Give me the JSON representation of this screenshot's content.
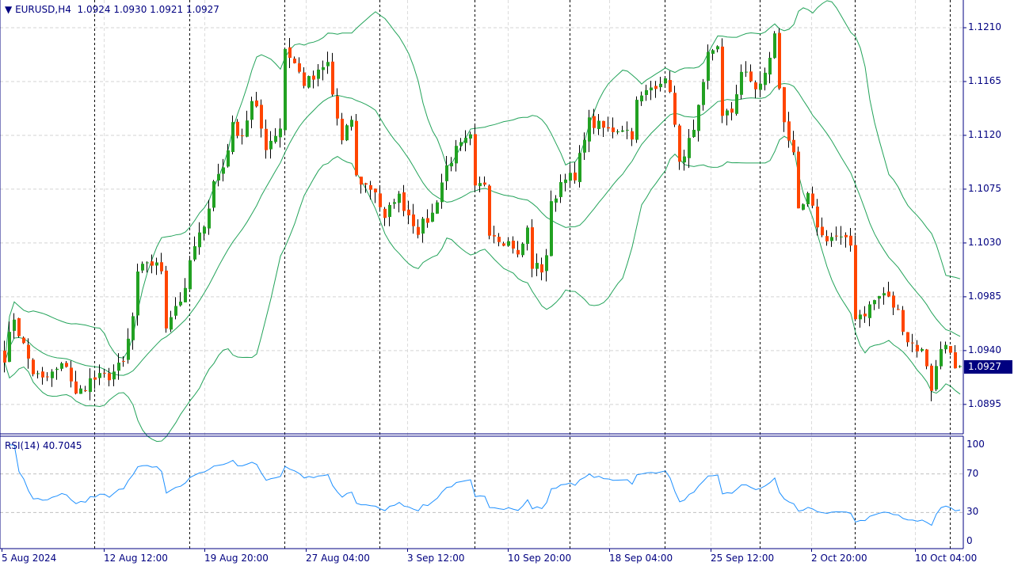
{
  "header": {
    "symbol": "EURUSD,H4",
    "ohlc": "1.0924 1.0930 1.0921 1.0927"
  },
  "last_price": "1.0927",
  "rsi_label": "RSI(14) 40.7045",
  "colors": {
    "bull": "#22a122",
    "bear": "#ff4500",
    "bands": "#23a35a",
    "rsi": "#1e90ff",
    "axis": "#000080",
    "tag": "#000080"
  },
  "chart_data": {
    "type": "candlestick",
    "title": "EURUSD,H4",
    "indicators": [
      "Bollinger Bands (20, 2)",
      "RSI(14)"
    ],
    "price_ticks": [
      "1.1210",
      "1.1165",
      "1.1120",
      "1.1075",
      "1.1030",
      "1.0985",
      "1.0940",
      "1.0895"
    ],
    "price_tick_values": [
      1.121,
      1.1165,
      1.112,
      1.1075,
      1.103,
      1.0985,
      1.094,
      1.0895
    ],
    "rsi_ticks": [
      "100",
      "70",
      "30",
      "0"
    ],
    "rsi_tick_values": [
      100,
      70,
      30,
      0
    ],
    "time_labels": [
      "5 Aug 2024",
      "12 Aug 12:00",
      "19 Aug 20:00",
      "27 Aug 04:00",
      "3 Sep 12:00",
      "10 Sep 20:00",
      "18 Sep 04:00",
      "25 Sep 12:00",
      "2 Oct 20:00",
      "10 Oct 04:00"
    ],
    "bar_count": 202,
    "close_path": [
      [
        0,
        1.0935
      ],
      [
        2,
        1.0968
      ],
      [
        3,
        1.0955
      ],
      [
        6,
        1.0922
      ],
      [
        8,
        1.0915
      ],
      [
        13,
        1.0929
      ],
      [
        15,
        1.0902
      ],
      [
        18,
        1.0915
      ],
      [
        22,
        1.0919
      ],
      [
        25,
        1.0929
      ],
      [
        27,
        1.0968
      ],
      [
        28,
        1.1002
      ],
      [
        30,
        1.1015
      ],
      [
        33,
        1.1008
      ],
      [
        34,
        1.0962
      ],
      [
        36,
        1.0978
      ],
      [
        38,
        1.0988
      ],
      [
        39,
        1.1015
      ],
      [
        41,
        1.1035
      ],
      [
        43,
        1.1061
      ],
      [
        44,
        1.1081
      ],
      [
        46,
        1.1094
      ],
      [
        48,
        1.1127
      ],
      [
        50,
        1.1121
      ],
      [
        52,
        1.1147
      ],
      [
        53,
        1.114
      ],
      [
        55,
        1.1111
      ],
      [
        58,
        1.1127
      ],
      [
        58,
        1.1167
      ],
      [
        59,
        1.1193
      ],
      [
        61,
        1.118
      ],
      [
        63,
        1.1164
      ],
      [
        65,
        1.1167
      ],
      [
        68,
        1.118
      ],
      [
        69,
        1.1154
      ],
      [
        71,
        1.1114
      ],
      [
        73,
        1.1134
      ],
      [
        73,
        1.1088
      ],
      [
        76,
        1.1078
      ],
      [
        78,
        1.1074
      ],
      [
        80,
        1.1048
      ],
      [
        82,
        1.1068
      ],
      [
        83,
        1.1068
      ],
      [
        85,
        1.1054
      ],
      [
        87,
        1.1041
      ],
      [
        90,
        1.1054
      ],
      [
        92,
        1.1081
      ],
      [
        93,
        1.1094
      ],
      [
        95,
        1.1107
      ],
      [
        97,
        1.1114
      ],
      [
        98,
        1.1117
      ],
      [
        99,
        1.1074
      ],
      [
        101,
        1.1081
      ],
      [
        102,
        1.1041
      ],
      [
        104,
        1.1035
      ],
      [
        107,
        1.1028
      ],
      [
        108,
        1.1018
      ],
      [
        110,
        1.1041
      ],
      [
        111,
        1.1011
      ],
      [
        113,
        1.1008
      ],
      [
        114,
        1.1021
      ],
      [
        115,
        1.1061
      ],
      [
        117,
        1.1081
      ],
      [
        118,
        1.1088
      ],
      [
        120,
        1.1081
      ],
      [
        122,
        1.1121
      ],
      [
        123,
        1.1131
      ],
      [
        127,
        1.1124
      ],
      [
        130,
        1.1127
      ],
      [
        132,
        1.1121
      ],
      [
        133,
        1.1147
      ],
      [
        136,
        1.116
      ],
      [
        138,
        1.1167
      ],
      [
        140,
        1.116
      ],
      [
        142,
        1.1094
      ],
      [
        143,
        1.1107
      ],
      [
        145,
        1.1121
      ],
      [
        147,
        1.116
      ],
      [
        148,
        1.1187
      ],
      [
        150,
        1.1197
      ],
      [
        151,
        1.1134
      ],
      [
        153,
        1.114
      ],
      [
        155,
        1.1174
      ],
      [
        158,
        1.116
      ],
      [
        158,
        1.1154
      ],
      [
        160,
        1.117
      ],
      [
        162,
        1.1203
      ],
      [
        163,
        1.116
      ],
      [
        164,
        1.1134
      ],
      [
        166,
        1.1101
      ],
      [
        167,
        1.1054
      ],
      [
        169,
        1.1068
      ],
      [
        172,
        1.1035
      ],
      [
        175,
        1.1035
      ],
      [
        178,
        1.1028
      ],
      [
        178,
        1.0968
      ],
      [
        181,
        1.0972
      ],
      [
        183,
        1.0982
      ],
      [
        185,
        1.0988
      ],
      [
        188,
        1.0972
      ],
      [
        190,
        1.0949
      ],
      [
        193,
        1.0939
      ],
      [
        194,
        1.0929
      ],
      [
        195,
        1.0909
      ],
      [
        197,
        1.0942
      ],
      [
        198,
        1.0949
      ],
      [
        200,
        1.0922
      ],
      [
        201,
        1.0927
      ]
    ]
  }
}
